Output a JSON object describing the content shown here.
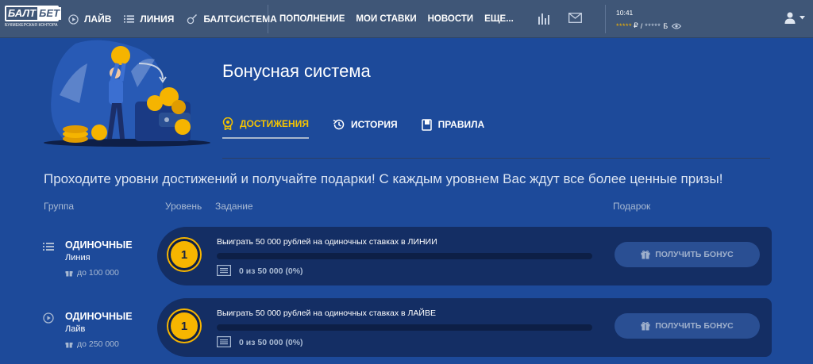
{
  "header": {
    "logo": {
      "text_a": "БАЛТ",
      "text_b": "БЕТ",
      "subtitle": "БУКМЕКЕРСКАЯ КОНТОРА"
    },
    "nav_primary": [
      {
        "label": "ЛАЙВ",
        "icon": "play-circle-icon"
      },
      {
        "label": "ЛИНИЯ",
        "icon": "list-icon"
      },
      {
        "label": "БАЛТСИСТЕМА",
        "icon": "guitar-icon"
      }
    ],
    "nav_secondary": [
      {
        "label": "ПОПОЛНЕНИЕ"
      },
      {
        "label": "МОИ СТАВКИ"
      },
      {
        "label": "НОВОСТИ"
      },
      {
        "label": "ЕЩЕ..."
      }
    ],
    "icons": [
      "stats-icon",
      "mail-icon",
      "eye-icon",
      "user-icon",
      "chevron-down-icon"
    ],
    "time": "10:41",
    "balance_main_stars": "*****",
    "balance_main_currency": "₽",
    "balance_separator": "/",
    "balance_bonus_stars": "*****",
    "balance_bonus_currency": "Б"
  },
  "page": {
    "title": "Бонусная система",
    "tabs": [
      {
        "label": "ДОСТИЖЕНИЯ",
        "icon": "medal-icon",
        "active": true
      },
      {
        "label": "ИСТОРИЯ",
        "icon": "history-icon",
        "active": false
      },
      {
        "label": "ПРАВИЛА",
        "icon": "book-icon",
        "active": false
      }
    ],
    "intro": "Проходите уровни достижений и получайте подарки! С каждым уровнем Вас ждут все более ценные призы!",
    "columns": {
      "group": "Группа",
      "level": "Уровень",
      "task": "Задание",
      "gift": "Подарок"
    }
  },
  "achievements": [
    {
      "group_title": "ОДИНОЧНЫЕ",
      "group_sub": "Линия",
      "group_icon": "list-icon",
      "prize": "до 100 000",
      "level": "1",
      "task": "Выиграть 50 000 рублей на одиночных ставках в ЛИНИИ",
      "progress_text": "0 из 50 000 (0%)",
      "progress": 0,
      "button_label": "ПОЛУЧИТЬ БОНУС"
    },
    {
      "group_title": "ОДИНОЧНЫЕ",
      "group_sub": "Лайв",
      "group_icon": "play-circle-icon",
      "prize": "до 250 000",
      "level": "1",
      "task": "Выиграть 50 000 рублей на одиночных ставках в ЛАЙВЕ",
      "progress_text": "0 из 50 000 (0%)",
      "progress": 0,
      "button_label": "ПОЛУЧИТЬ БОНУС"
    }
  ],
  "colors": {
    "background": "#1d4a9a",
    "header": "#3f5677",
    "card": "#142e64",
    "accent": "#f5c400",
    "level_badge": "#f7b500",
    "button": "#2a4f93"
  }
}
